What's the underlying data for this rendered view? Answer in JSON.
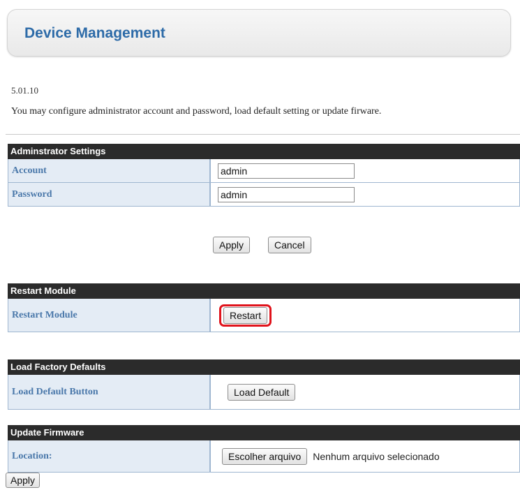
{
  "header": {
    "title": "Device Management"
  },
  "version": "5.01.10",
  "description": "You may configure administrator account and password, load default setting or update firware.",
  "admin": {
    "header": "Adminstrator Settings",
    "account_label": "Account",
    "account_value": "admin",
    "password_label": "Password",
    "password_value": "admin",
    "apply_label": "Apply",
    "cancel_label": "Cancel"
  },
  "restart": {
    "header": "Restart Module",
    "label": "Restart Module",
    "button_label": "Restart",
    "highlight_color": "#e0131b"
  },
  "factory": {
    "header": "Load Factory Defaults",
    "label": "Load Default Button",
    "button_label": "Load Default"
  },
  "firmware": {
    "header": "Update Firmware",
    "location_label": "Location:",
    "choose_file_label": "Escolher arquivo",
    "no_file_text": "Nenhum arquivo selecionado",
    "apply_label": "Apply"
  },
  "colors": {
    "title": "#2d6ba8",
    "section_header_bg": "#2b2b2b",
    "label_bg": "#e4ecf5",
    "label_text": "#4a78aa"
  }
}
